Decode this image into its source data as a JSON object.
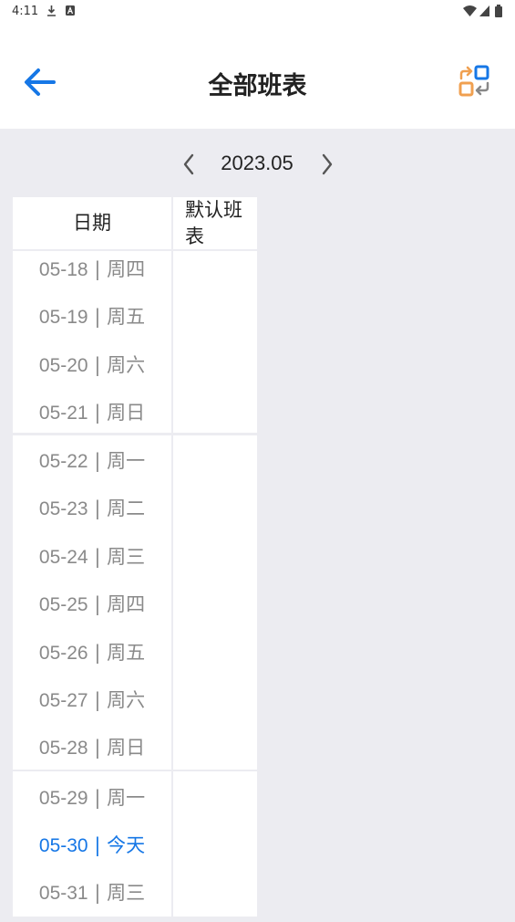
{
  "status_bar": {
    "time": "4:11",
    "icons": [
      "download-icon",
      "a-badge-icon",
      "wifi-icon",
      "signal-icon",
      "battery-icon"
    ]
  },
  "header": {
    "title": "全部班表",
    "back_icon": "arrow-left-icon",
    "switch_icon": "swap-icon",
    "accent_color": "#1677e6",
    "orange_color": "#f0a050"
  },
  "month_nav": {
    "label": "2023.05",
    "prev_icon": "chevron-left-icon",
    "next_icon": "chevron-right-icon"
  },
  "table": {
    "col_date": "日期",
    "col_schedule": "默认班表",
    "weeks": [
      {
        "days": [
          {
            "date": "05-18",
            "sep": "|",
            "weekday": "周四"
          },
          {
            "date": "05-19",
            "sep": "|",
            "weekday": "周五"
          },
          {
            "date": "05-20",
            "sep": "|",
            "weekday": "周六"
          },
          {
            "date": "05-21",
            "sep": "|",
            "weekday": "周日"
          }
        ]
      },
      {
        "days": [
          {
            "date": "05-22",
            "sep": "|",
            "weekday": "周一"
          },
          {
            "date": "05-23",
            "sep": "|",
            "weekday": "周二"
          },
          {
            "date": "05-24",
            "sep": "|",
            "weekday": "周三"
          },
          {
            "date": "05-25",
            "sep": "|",
            "weekday": "周四"
          },
          {
            "date": "05-26",
            "sep": "|",
            "weekday": "周五"
          },
          {
            "date": "05-27",
            "sep": "|",
            "weekday": "周六"
          },
          {
            "date": "05-28",
            "sep": "|",
            "weekday": "周日"
          }
        ]
      },
      {
        "days": [
          {
            "date": "05-29",
            "sep": "|",
            "weekday": "周一"
          },
          {
            "date": "05-30",
            "sep": "|",
            "weekday": "今天",
            "today": true
          },
          {
            "date": "05-31",
            "sep": "|",
            "weekday": "周三"
          }
        ]
      }
    ]
  }
}
